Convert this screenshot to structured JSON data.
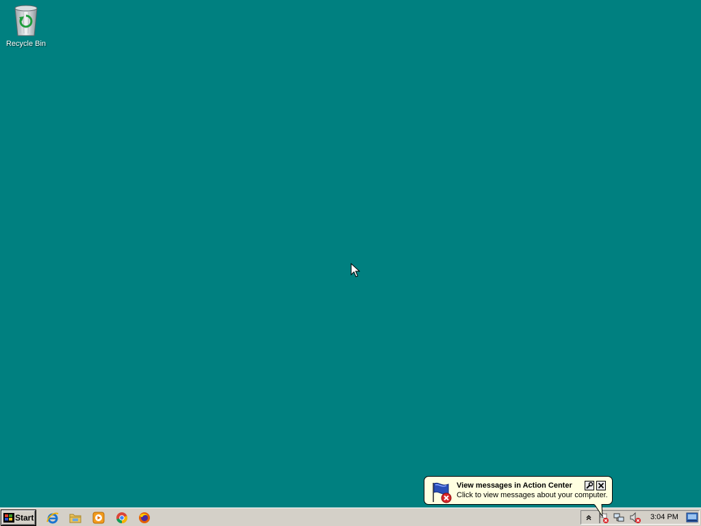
{
  "desktop": {
    "background": "#008080",
    "icons": [
      {
        "label": "Recycle Bin",
        "icon": "recycle-bin-icon"
      }
    ]
  },
  "balloon": {
    "title": "View messages in Action Center",
    "text": "Click to view messages about your computer.",
    "icon": "action-center-flag-icon",
    "options_icon": "wrench-icon",
    "close_icon": "close-icon",
    "background": "#ffffe1"
  },
  "taskbar": {
    "start_label": "Start",
    "quick_launch": [
      {
        "name": "internet-explorer",
        "icon": "internet-explorer-icon"
      },
      {
        "name": "file-explorer",
        "icon": "folder-icon"
      },
      {
        "name": "media-player",
        "icon": "media-player-icon"
      },
      {
        "name": "chrome",
        "icon": "chrome-icon"
      },
      {
        "name": "firefox",
        "icon": "firefox-icon"
      }
    ],
    "tray": {
      "icons": [
        "show-hidden-icons-icon",
        "action-center-flag-icon",
        "network-icon",
        "volume-muted-icon"
      ],
      "clock": "3:04 PM"
    }
  }
}
